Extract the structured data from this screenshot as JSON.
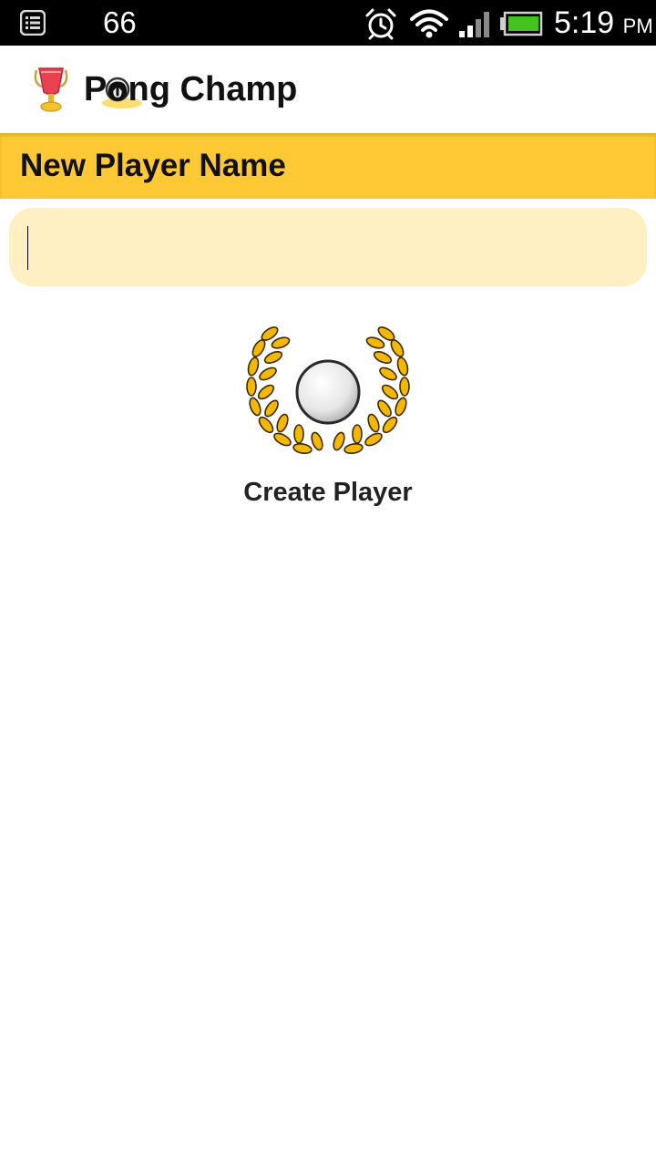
{
  "status_bar": {
    "notification_count": "66",
    "time": "5:19",
    "ampm": "PM",
    "icons": [
      "notification-list-icon",
      "alarm-icon",
      "wifi-icon",
      "signal-icon",
      "battery-icon"
    ]
  },
  "app": {
    "title": "Pong Champ",
    "logo_icon": "trophy-cup-icon"
  },
  "section": {
    "title": "New Player Name"
  },
  "name_input": {
    "value": "",
    "placeholder": ""
  },
  "create_player": {
    "label": "Create Player",
    "icon": "laurel-wreath-ball-icon"
  },
  "colors": {
    "header_yellow": "#ffc935",
    "input_bg": "#fff0c3",
    "laurel_gold": "#f5b800"
  }
}
